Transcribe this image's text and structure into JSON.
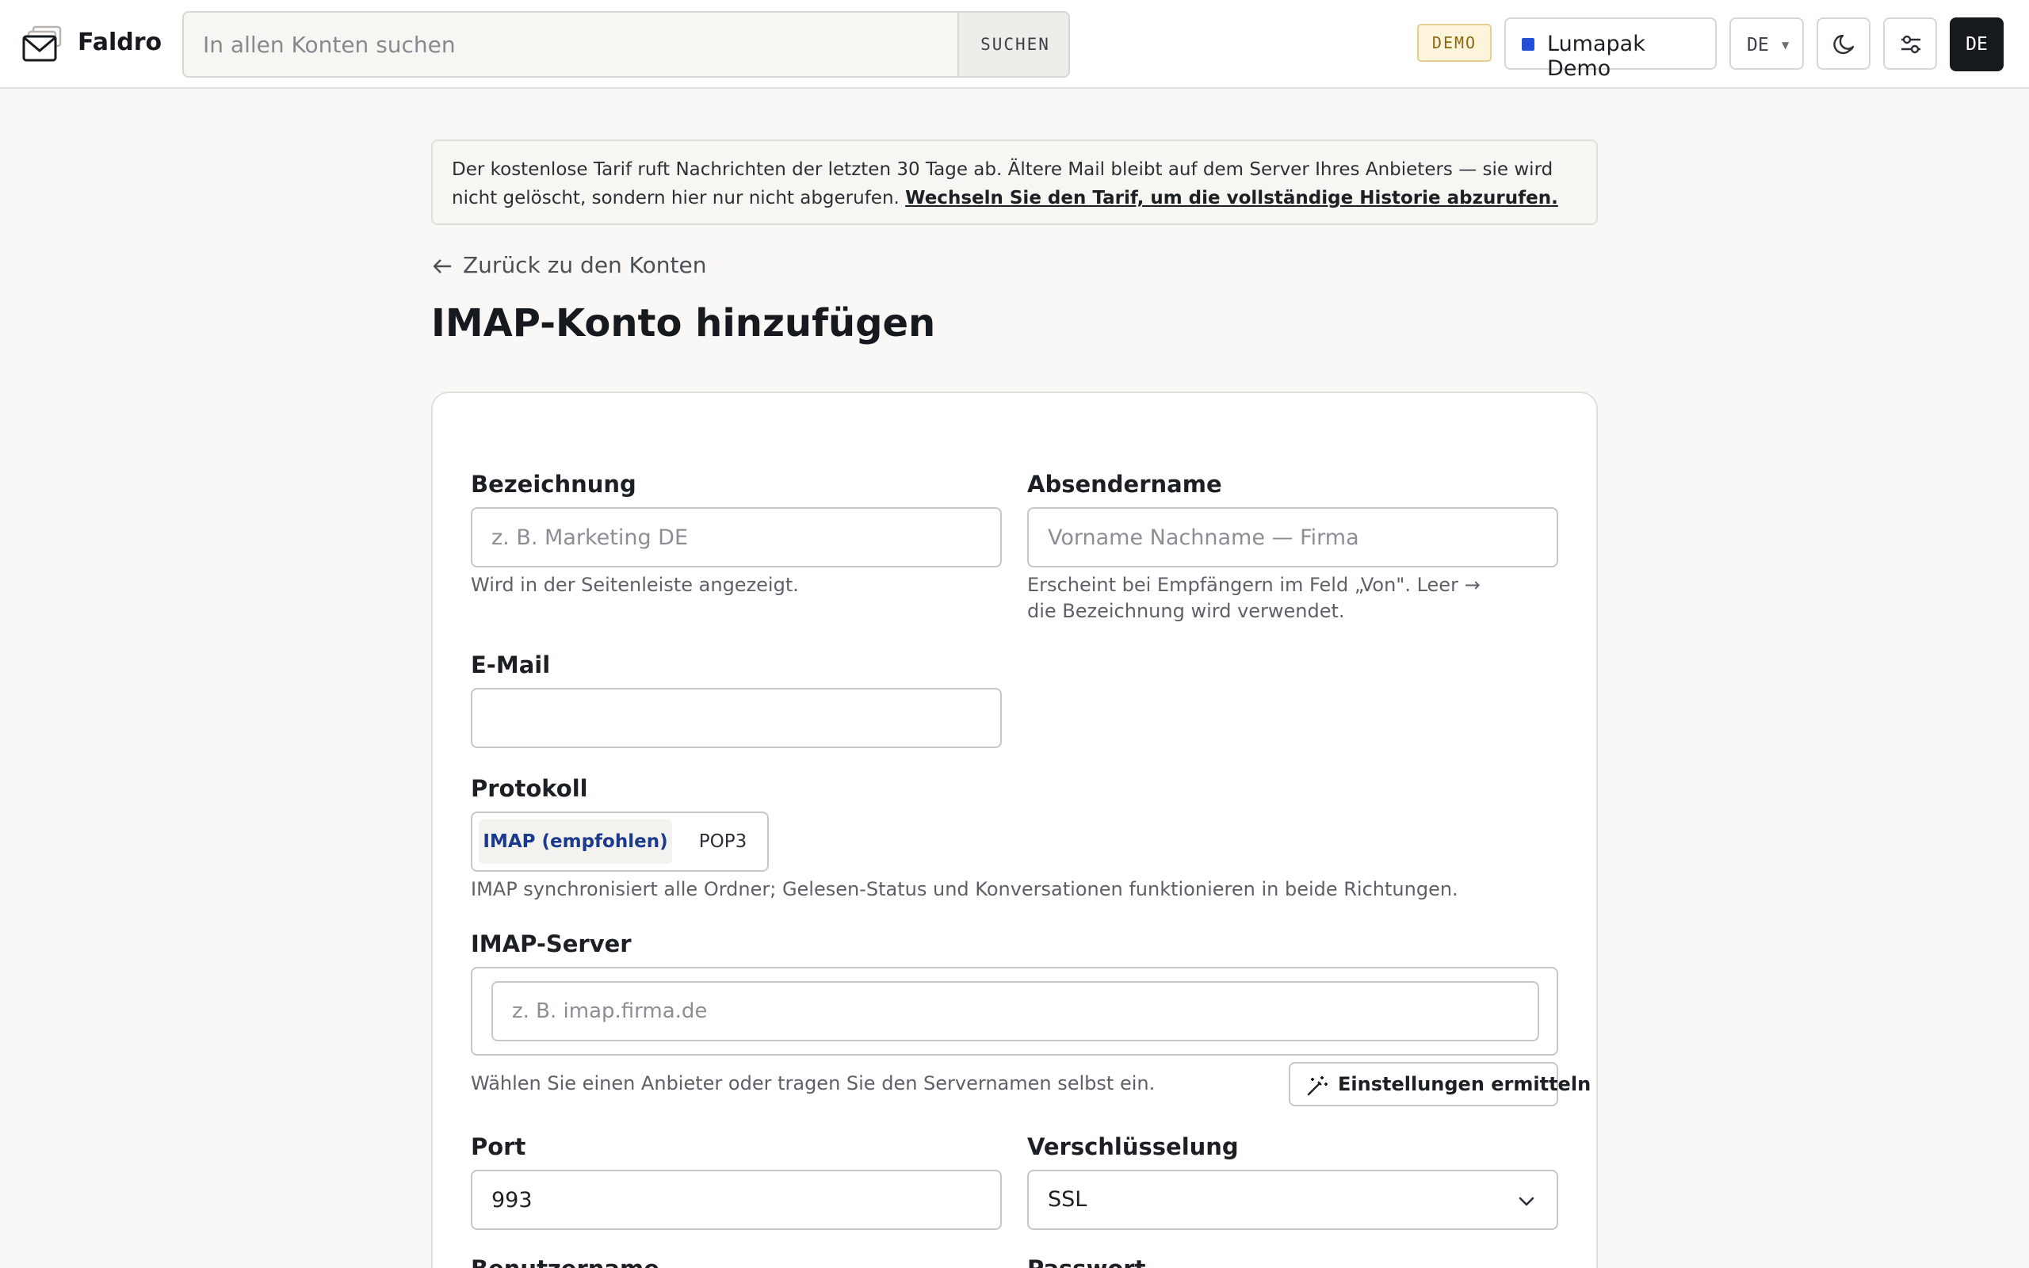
{
  "app": {
    "name": "Faldro"
  },
  "header": {
    "search_placeholder": "In allen Konten suchen",
    "search_button": "SUCHEN",
    "demo_badge": "DEMO",
    "account": {
      "label": "Lumapak Demo",
      "color": "#2550d6"
    },
    "language": "DE",
    "avatar_initials": "DE"
  },
  "notice": {
    "text": "Der kostenlose Tarif ruft Nachrichten der letzten 30 Tage ab. Ältere Mail bleibt auf dem Server Ihres Anbieters — sie wird nicht gelöscht, sondern hier nur nicht abgerufen.",
    "link": "Wechseln Sie den Tarif, um die vollständige Historie abzurufen."
  },
  "back_link": "Zurück zu den Konten",
  "page_title": "IMAP-Konto hinzufügen",
  "form": {
    "bezeichnung": {
      "label": "Bezeichnung",
      "placeholder": "z. B. Marketing DE",
      "value": "",
      "hint": "Wird in der Seitenleiste angezeigt."
    },
    "absendername": {
      "label": "Absendername",
      "placeholder": "Vorname Nachname — Firma",
      "value": "",
      "hint": "Erscheint bei Empfängern im Feld „Von\". Leer → die Bezeichnung wird verwendet."
    },
    "email": {
      "label": "E-Mail",
      "value": ""
    },
    "protokoll": {
      "label": "Protokoll",
      "options": [
        "IMAP (empfohlen)",
        "POP3"
      ],
      "selected": "IMAP (empfohlen)",
      "hint": "IMAP synchronisiert alle Ordner; Gelesen-Status und Konversationen funktionieren in beide Richtungen."
    },
    "server": {
      "label": "IMAP-Server",
      "placeholder": "z. B. imap.firma.de",
      "hint": "Wählen Sie einen Anbieter oder tragen Sie den Servernamen selbst ein.",
      "detect_button": "Einstellungen ermitteln"
    },
    "port": {
      "label": "Port",
      "value": "993"
    },
    "verschluesselung": {
      "label": "Verschlüsselung",
      "value": "SSL"
    },
    "benutzername": {
      "label": "Benutzername"
    },
    "passwort": {
      "label": "Passwort"
    }
  },
  "colors": {
    "accent": "#1b3a8c",
    "dark": "#16191d",
    "demo_badge_bg": "#fdf4dc"
  }
}
